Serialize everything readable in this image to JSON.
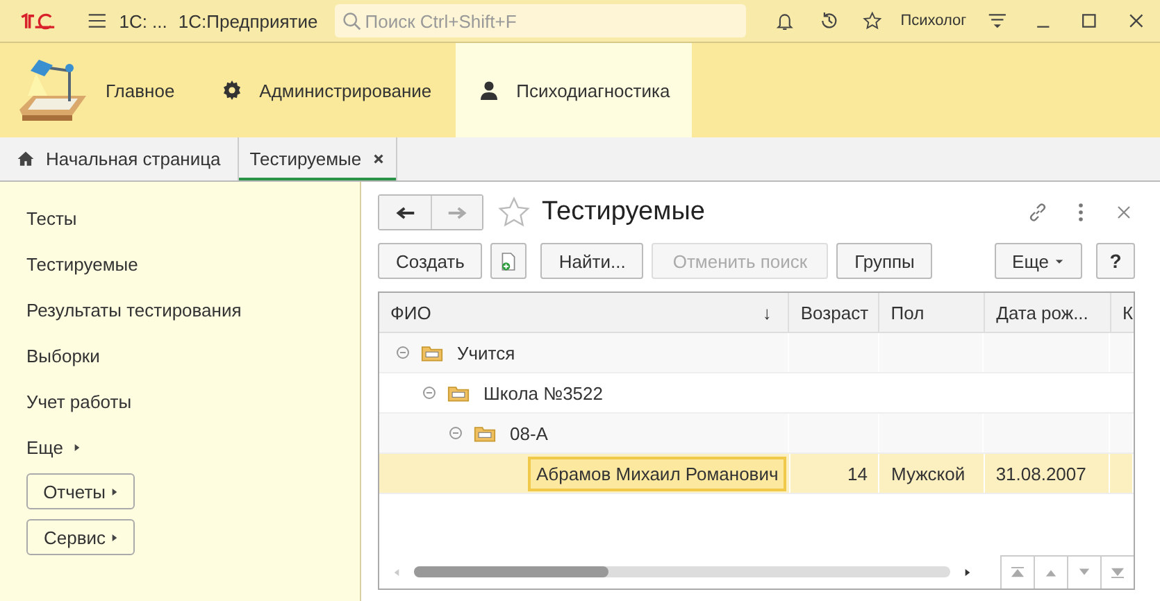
{
  "title_bar": {
    "app_name": "1С: ...",
    "product": "1С:Предприятие",
    "search": {
      "placeholder": "Поиск Ctrl+Shift+F"
    },
    "user": "Психолог"
  },
  "sections": [
    {
      "label": "Главное",
      "selected": false
    },
    {
      "label": "Администрирование",
      "selected": false
    },
    {
      "label": "Психодиагностика",
      "selected": true
    }
  ],
  "tabs": [
    {
      "label": "Начальная страница",
      "selected": false
    },
    {
      "label": "Тестируемые",
      "selected": true
    }
  ],
  "sidebar": {
    "items": [
      "Тесты",
      "Тестируемые",
      "Результаты тестирования",
      "Выборки",
      "Учет работы"
    ],
    "more": "Еще",
    "buttons": [
      "Отчеты",
      "Сервис"
    ]
  },
  "form": {
    "title": "Тестируемые",
    "toolbar": [
      {
        "label": "Создать",
        "disabled": false
      },
      {
        "label": "Найти...",
        "disabled": false
      },
      {
        "label": "Отменить поиск",
        "disabled": true
      },
      {
        "label": "Группы",
        "disabled": false
      }
    ],
    "more": "Еще",
    "help": "?"
  },
  "table": {
    "columns": [
      "ФИО",
      "Возраст",
      "Пол",
      "Дата рож...",
      "К"
    ],
    "sort_mark": "↓",
    "rows": [
      {
        "name": "Учится",
        "expanded": true,
        "children": [
          {
            "name": "Школа №3522",
            "expanded": true,
            "children": [
              {
                "name": "08-А",
                "expanded": true,
                "children": [
                  {
                    "name": "Абрамов Михаил Романович",
                    "age": "14",
                    "sex": "Мужской",
                    "birth": "31.08.2007",
                    "selected": true
                  }
                ]
              }
            ]
          }
        ]
      }
    ]
  }
}
